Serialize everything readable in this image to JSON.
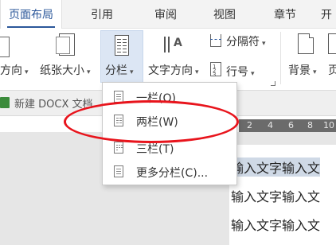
{
  "tabs": [
    {
      "label": "页面布局",
      "active": true
    },
    {
      "label": "引用"
    },
    {
      "label": "审阅"
    },
    {
      "label": "视图"
    },
    {
      "label": "章节"
    },
    {
      "label": "开"
    }
  ],
  "ribbon": {
    "orientation_label": "方向",
    "paper_size_label": "纸张大小",
    "columns_label": "分栏",
    "text_direction_label": "文字方向",
    "separator_label": "分隔符",
    "line_number_label": "行号",
    "background_label": "背景",
    "page_partial_label": "页"
  },
  "document_tab": {
    "name": "新建 DOCX 文档"
  },
  "ruler": {
    "numbers": [
      "2",
      "4",
      "6",
      "8",
      "10"
    ]
  },
  "columns_menu": {
    "items": [
      {
        "label": "一栏(O)"
      },
      {
        "label": "两栏(W)"
      },
      {
        "label": "三栏(T)"
      },
      {
        "label": "更多分栏(C)..."
      }
    ]
  },
  "document": {
    "lines": [
      "输入文字输入文",
      "输入文字输入文",
      "输入文字输入文"
    ]
  },
  "colors": {
    "accent": "#2b579a",
    "highlight": "#dce6f4",
    "annotation": "#e8141c"
  }
}
